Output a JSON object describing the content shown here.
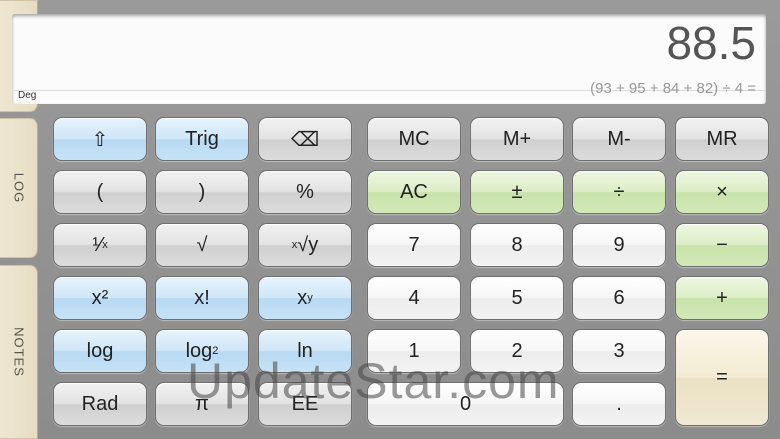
{
  "sidebar": {
    "tabs": [
      {
        "label": "LOG"
      },
      {
        "label": "NOTES"
      }
    ]
  },
  "display": {
    "result": "88.5",
    "expression": "(93 + 95 + 84 + 82) ÷ 4 =",
    "angle_mode": "Deg"
  },
  "keys": {
    "shift": "⇧",
    "trig": "Trig",
    "backspace": "⌫",
    "open_paren": "(",
    "close_paren": ")",
    "percent": "%",
    "reciprocal_main": "¹⁄",
    "reciprocal_sub": "x",
    "sqrt": "√",
    "root_sup": "x",
    "root_main": "√y",
    "square": "x²",
    "factorial": "x!",
    "power_main": "x",
    "power_sup": "y",
    "log": "log",
    "log2_main": "log",
    "log2_sub": "2",
    "ln": "ln",
    "rad": "Rad",
    "pi": "π",
    "ee": "EE",
    "mc": "MC",
    "mplus": "M+",
    "mminus": "M-",
    "mr": "MR",
    "ac": "AC",
    "plusminus": "±",
    "divide": "÷",
    "multiply": "×",
    "seven": "7",
    "eight": "8",
    "nine": "9",
    "minus": "−",
    "four": "4",
    "five": "5",
    "six": "6",
    "plus": "+",
    "one": "1",
    "two": "2",
    "three": "3",
    "equals": "=",
    "zero": "0",
    "decimal": "."
  },
  "watermark": "UpdateStar.com",
  "colors": {
    "blue_key": "#c7e2f6",
    "green_key": "#d3e8b8",
    "gray_key": "#dcdcdc",
    "white_key": "#f3f3f3"
  }
}
